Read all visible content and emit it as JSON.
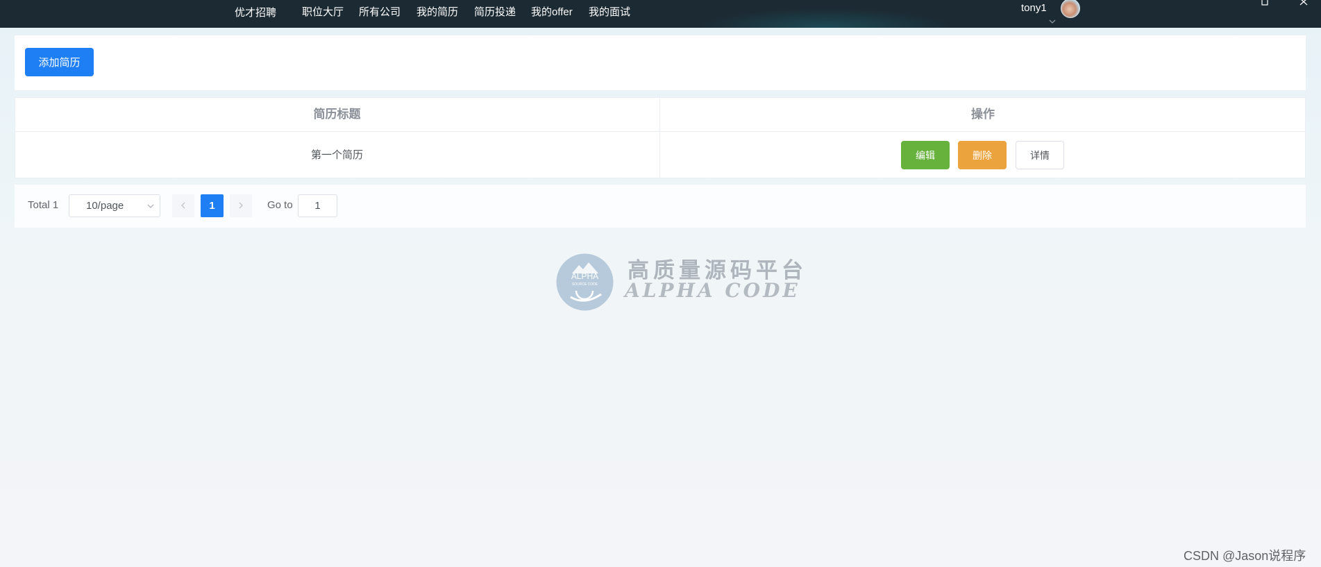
{
  "navbar": {
    "brand": "优才招聘",
    "items": [
      "职位大厅",
      "所有公司",
      "我的简历",
      "简历投递",
      "我的offer",
      "我的面试"
    ],
    "username": "tony1"
  },
  "toolbar": {
    "add_label": "添加简历"
  },
  "table": {
    "headers": [
      "简历标题",
      "操作"
    ],
    "rows": [
      {
        "title": "第一个简历"
      }
    ],
    "actions": {
      "edit": "编辑",
      "delete": "删除",
      "detail": "详情"
    }
  },
  "pagination": {
    "total": "Total 1",
    "page_size": "10/page",
    "current_page": "1",
    "goto_label": "Go to",
    "goto_value": "1"
  },
  "watermark": {
    "cn": "高质量源码平台",
    "en": "ALPHA CODE",
    "logo_text": "ALPHA",
    "logo_sub": "SOURCE CODE"
  },
  "footer": {
    "csdn": "CSDN @Jason说程序"
  },
  "colors": {
    "navbar": "#1b2329",
    "primary": "#1e7ff5",
    "success": "#67b23d",
    "warning": "#eba33d"
  }
}
